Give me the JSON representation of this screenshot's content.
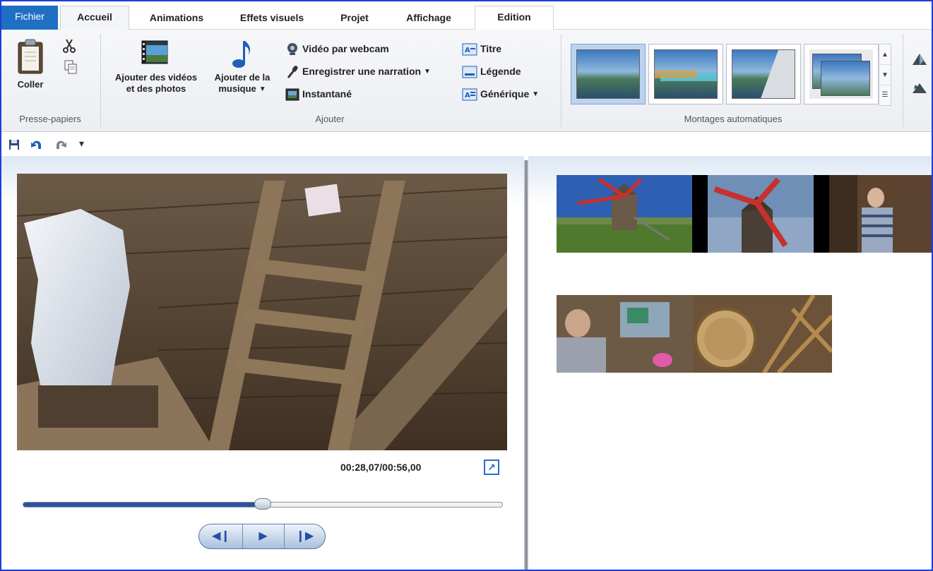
{
  "tabs": {
    "file": "Fichier",
    "home": "Accueil",
    "animations": "Animations",
    "visual_effects": "Effets visuels",
    "project": "Projet",
    "view": "Affichage",
    "edit": "Edition"
  },
  "ribbon": {
    "clipboard": {
      "paste": "Coller",
      "group": "Presse-papiers"
    },
    "add": {
      "add_videos_line1": "Ajouter des vidéos",
      "add_videos_line2": "et des photos",
      "add_music_line1": "Ajouter de la",
      "add_music_line2": "musique",
      "webcam": "Vidéo par webcam",
      "narration": "Enregistrer une narration",
      "snapshot": "Instantané",
      "title": "Titre",
      "caption": "Légende",
      "credits": "Générique",
      "group": "Ajouter"
    },
    "automovie": {
      "group": "Montages automatiques",
      "selected_index": 0
    }
  },
  "player": {
    "timecode": "00:28,07/00:56,00",
    "progress_fraction": 0.5
  },
  "storyboard": {
    "row_count": 2,
    "clip_count": 5
  },
  "colors": {
    "file_tab": "#1f6fc4",
    "accent": "#2952a3",
    "frame_border": "#1e3ed8"
  }
}
